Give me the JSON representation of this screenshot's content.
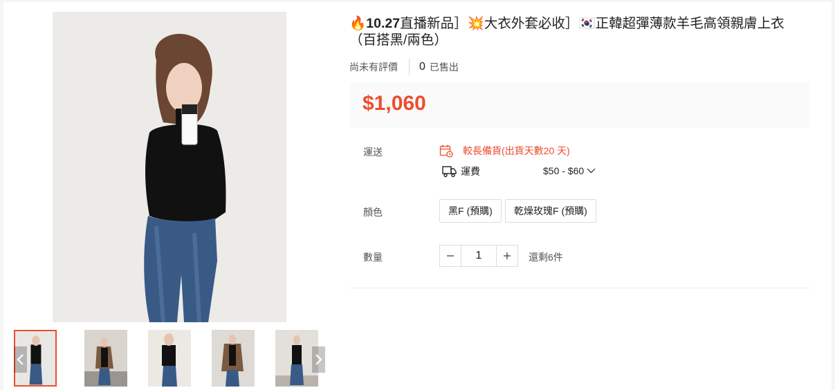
{
  "product": {
    "title_line1_emoji": "🔥",
    "title_line1_bold": "10.27",
    "title_line1_rest": "直播新品］💥大衣外套必收］🇰🇷正韓超彈薄款羊毛高領親膚上衣",
    "title_line2": "（百搭黑/兩色）",
    "rating_text": "尚未有評價",
    "sold_count": "0",
    "sold_label": "已售出",
    "price": "$1,060"
  },
  "shipping": {
    "label": "運送",
    "warning": "較長備貨(出貨天數20 天)",
    "fee_label": "運費",
    "fee_range": "$50 - $60"
  },
  "color": {
    "label": "顏色",
    "options": [
      "黑F (預購)",
      "乾燥玫瑰F (預購)"
    ]
  },
  "quantity": {
    "label": "數量",
    "value": "1",
    "stock_text": "還剩6件"
  },
  "gallery": {
    "thumbnail_count": 5,
    "active_index": 0
  },
  "colors": {
    "accent": "#ee4d2d",
    "text_muted": "#555555",
    "price_bg": "#fafafa"
  }
}
